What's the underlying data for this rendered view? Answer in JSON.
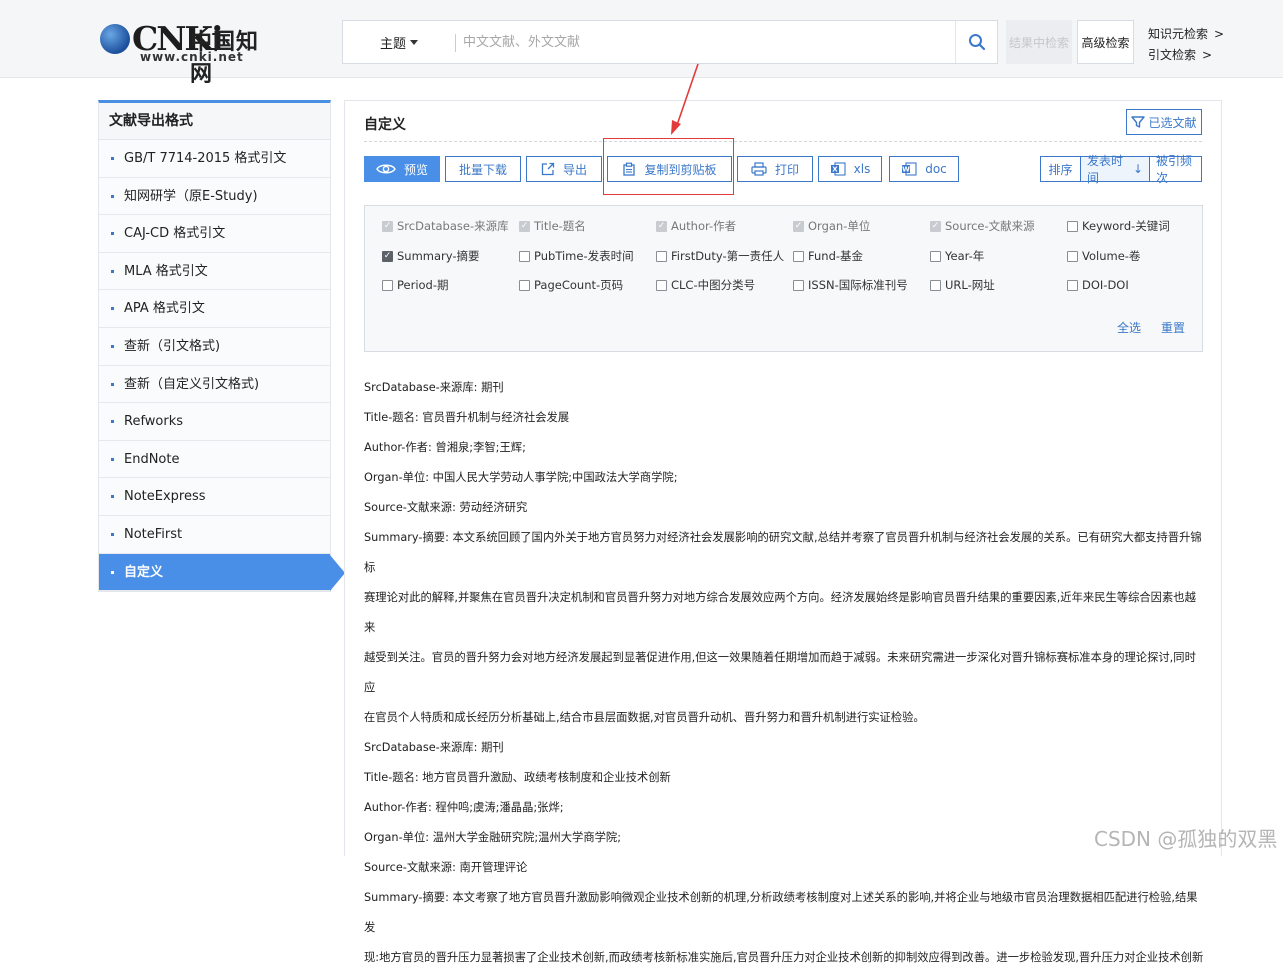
{
  "header": {
    "logo_mark": "CNKi",
    "logo_cn": "中国知网",
    "logo_url": "www.cnki.net",
    "search_type": "主题",
    "search_placeholder": "中文文献、外文文献",
    "result_search": "结果中检索",
    "advanced_search": "高级检索",
    "link_knowledge": "知识元检索",
    "link_citation": "引文检索",
    "link_arrow": ">"
  },
  "sidebar": {
    "title": "文献导出格式",
    "items": [
      {
        "label": "GB/T 7714-2015 格式引文",
        "active": false
      },
      {
        "label": "知网研学（原E-Study)",
        "active": false
      },
      {
        "label": "CAJ-CD 格式引文",
        "active": false
      },
      {
        "label": "MLA 格式引文",
        "active": false
      },
      {
        "label": "APA 格式引文",
        "active": false
      },
      {
        "label": "查新（引文格式)",
        "active": false
      },
      {
        "label": "查新（自定义引文格式)",
        "active": false
      },
      {
        "label": "Refworks",
        "active": false
      },
      {
        "label": "EndNote",
        "active": false
      },
      {
        "label": "NoteExpress",
        "active": false
      },
      {
        "label": "NoteFirst",
        "active": false
      },
      {
        "label": "自定义",
        "active": true
      }
    ]
  },
  "panel": {
    "title": "自定义",
    "selected_docs": "已选文献",
    "toolbar": {
      "preview": "预览",
      "batch_download": "批量下载",
      "export": "导出",
      "copy_clipboard": "复制到剪贴板",
      "print": "打印",
      "xls": "xls",
      "doc": "doc"
    },
    "sort": {
      "label": "排序",
      "pubtime": "发表时间",
      "pubtime_arrow": "↓",
      "cited": "被引频次"
    }
  },
  "fields": [
    {
      "label": "SrcDatabase-来源库",
      "checked": true,
      "locked": true
    },
    {
      "label": "Title-题名",
      "checked": true,
      "locked": true
    },
    {
      "label": "Author-作者",
      "checked": true,
      "locked": true
    },
    {
      "label": "Organ-单位",
      "checked": true,
      "locked": true
    },
    {
      "label": "Source-文献来源",
      "checked": true,
      "locked": true
    },
    {
      "label": "Keyword-关键词",
      "checked": false,
      "locked": false
    },
    {
      "label": "Summary-摘要",
      "checked": true,
      "locked": false
    },
    {
      "label": "PubTime-发表时间",
      "checked": false,
      "locked": false
    },
    {
      "label": "FirstDuty-第一责任人",
      "checked": false,
      "locked": false
    },
    {
      "label": "Fund-基金",
      "checked": false,
      "locked": false
    },
    {
      "label": "Year-年",
      "checked": false,
      "locked": false
    },
    {
      "label": "Volume-卷",
      "checked": false,
      "locked": false
    },
    {
      "label": "Period-期",
      "checked": false,
      "locked": false
    },
    {
      "label": "PageCount-页码",
      "checked": false,
      "locked": false
    },
    {
      "label": "CLC-中图分类号",
      "checked": false,
      "locked": false
    },
    {
      "label": "ISSN-国际标准刊号",
      "checked": false,
      "locked": false
    },
    {
      "label": "URL-网址",
      "checked": false,
      "locked": false
    },
    {
      "label": "DOI-DOI",
      "checked": false,
      "locked": false
    }
  ],
  "field_actions": {
    "select_all": "全选",
    "reset": "重置"
  },
  "records": [
    {
      "src_label": "SrcDatabase-来源库:",
      "src": "期刊",
      "title_label": "Title-题名:",
      "title": "官员晋升机制与经济社会发展",
      "author_label": "Author-作者:",
      "author": "曾湘泉;李智;王辉;",
      "organ_label": "Organ-单位:",
      "organ": "中国人民大学劳动人事学院;中国政法大学商学院;",
      "source_label": "Source-文献来源:",
      "source": "劳动经济研究",
      "summary_label": "Summary-摘要:",
      "summary_lines": [
        "本文系统回顾了国内外关于地方官员努力对经济社会发展影响的研究文献,总结并考察了官员晋升机制与经济社会发展的关系。已有研究大都支持晋升锦标",
        "赛理论对此的解释,并聚焦在官员晋升决定机制和官员晋升努力对地方综合发展效应两个方向。经济发展始终是影响官员晋升结果的重要因素,近年来民生等综合因素也越来",
        "越受到关注。官员的晋升努力会对地方经济发展起到显著促进作用,但这一效果随着任期增加而趋于减弱。未来研究需进一步深化对晋升锦标赛标准本身的理论探讨,同时应",
        "在官员个人特质和成长经历分析基础上,结合市县层面数据,对官员晋升动机、晋升努力和晋升机制进行实证检验。"
      ]
    },
    {
      "src_label": "SrcDatabase-来源库:",
      "src": "期刊",
      "title_label": "Title-题名:",
      "title": "地方官员晋升激励、政绩考核制度和企业技术创新",
      "author_label": "Author-作者:",
      "author": "程仲鸣;虞涛;潘晶晶;张烨;",
      "organ_label": "Organ-单位:",
      "organ": "温州大学金融研究院;温州大学商学院;",
      "source_label": "Source-文献来源:",
      "source": "南开管理评论",
      "summary_label": "Summary-摘要:",
      "summary_lines": [
        "本文考察了地方官员晋升激励影响微观企业技术创新的机理,分析政绩考核制度对上述关系的影响,并将企业与地级市官员治理数据相匹配进行检验,结果发",
        "现:地方官员的晋升压力显著损害了企业技术创新,而政绩考核新标准实施后,官员晋升压力对企业技术创新的抑制效应得到改善。进一步检验发现,晋升压力对企业技术创新"
      ]
    }
  ],
  "watermark": "CSDN @孤独的双黑"
}
